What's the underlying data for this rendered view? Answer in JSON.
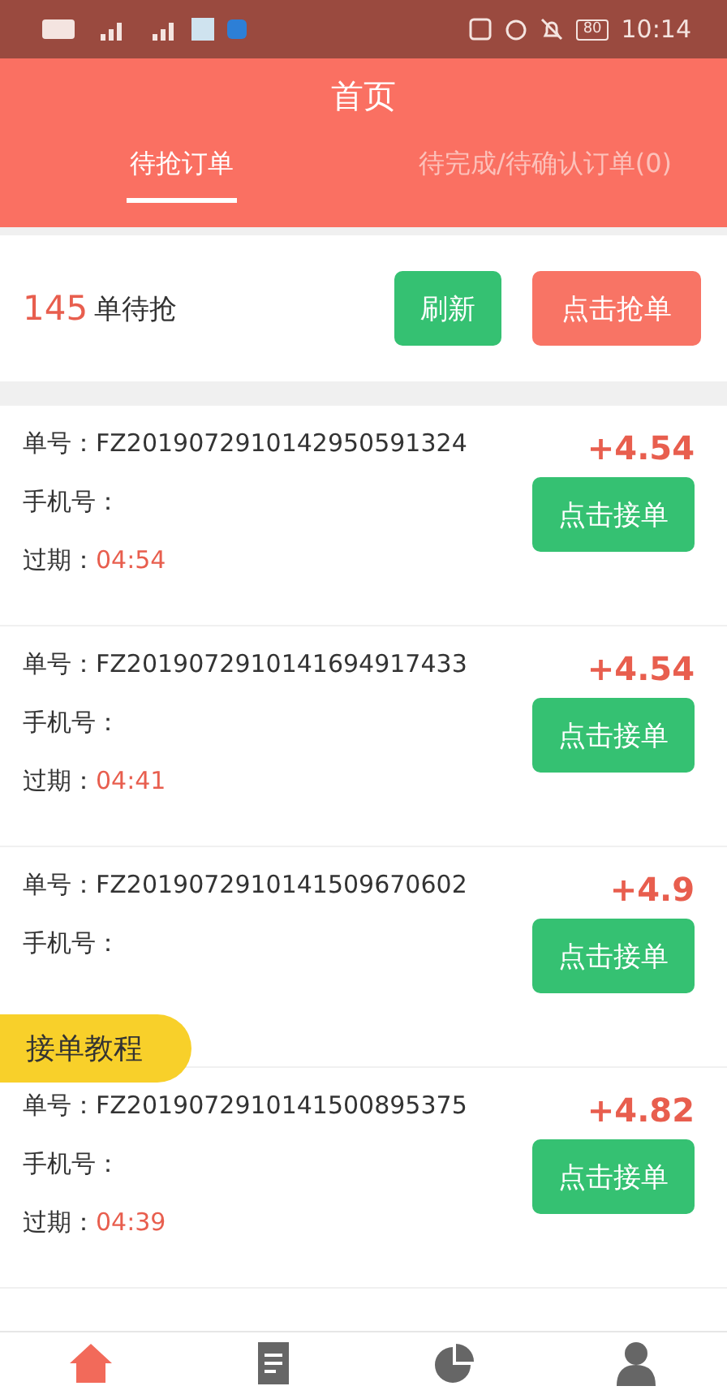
{
  "status_bar": {
    "time": "10:14",
    "battery": "80"
  },
  "header": {
    "title": "首页"
  },
  "tabs": [
    {
      "label": "待抢订单",
      "selected": true
    },
    {
      "label": "待完成/待确认订单(0)",
      "selected": false
    }
  ],
  "summary": {
    "count": "145",
    "label": "单待抢",
    "refresh_button": "刷新",
    "grab_button": "点击抢单"
  },
  "orders": [
    {
      "number_label": "单号：",
      "number": "FZ2019072910142950591324",
      "amount": "+4.54",
      "phone_label": "手机号：",
      "expiry_label": "过期：",
      "expiry": "04:54",
      "button": "点击接单"
    },
    {
      "number_label": "单号：",
      "number": "FZ2019072910141694917433",
      "amount": "+4.54",
      "phone_label": "手机号：",
      "expiry_label": "过期：",
      "expiry": "04:41",
      "button": "点击接单"
    },
    {
      "number_label": "单号：",
      "number": "FZ2019072910141509670602",
      "amount": "+4.9",
      "phone_label": "手机号：",
      "button": "点击接单"
    },
    {
      "number_label": "单号：",
      "number": "FZ2019072910141500895375",
      "amount": "+4.82",
      "phone_label": "手机号：",
      "expiry_label": "过期：",
      "expiry": "04:39",
      "button": "点击接单"
    }
  ],
  "tutorial_badge": "接单教程",
  "bottom_nav": [
    {
      "kind": "home",
      "selected": true
    },
    {
      "kind": "document",
      "selected": false
    },
    {
      "kind": "chart",
      "selected": false
    },
    {
      "kind": "person",
      "selected": false
    }
  ]
}
